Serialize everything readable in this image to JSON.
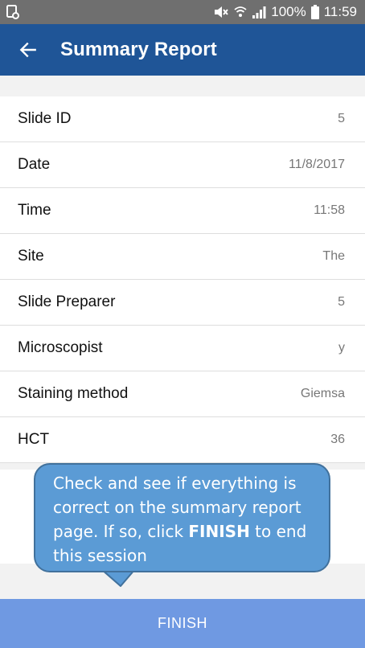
{
  "status_bar": {
    "battery_percent": "100%",
    "time": "11:59",
    "icons": [
      "notification-icon",
      "mute-icon",
      "wifi-icon",
      "signal-icon",
      "battery-icon"
    ]
  },
  "app_bar": {
    "title": "Summary Report",
    "back_icon": "arrow-back-icon",
    "background_color": "#1f5597"
  },
  "report": {
    "rows": [
      {
        "label": "Slide ID",
        "value": "5"
      },
      {
        "label": "Date",
        "value": "11/8/2017"
      },
      {
        "label": "Time",
        "value": "11:58"
      },
      {
        "label": "Site",
        "value": "The"
      },
      {
        "label": "Slide Preparer",
        "value": "5"
      },
      {
        "label": "Microscopist",
        "value": "y"
      },
      {
        "label": "Staining method",
        "value": "Giemsa"
      },
      {
        "label": "HCT",
        "value": "36"
      }
    ]
  },
  "callout": {
    "text_before": "Check and see if everything is correct on the summary report page. If so, click ",
    "emphasis": "FINISH",
    "text_after": " to end this session",
    "color": "#5b9bd5"
  },
  "footer": {
    "finish_label": "FINISH",
    "color": "#6f99e2"
  }
}
